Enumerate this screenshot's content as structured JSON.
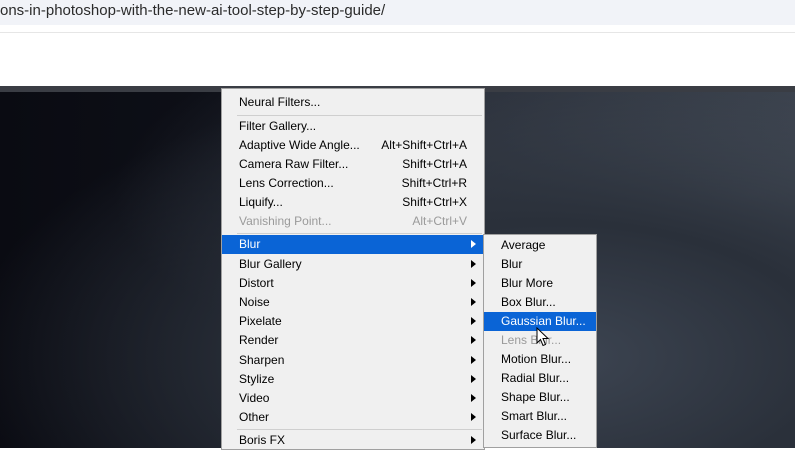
{
  "browser": {
    "url_fragment": "ons-in-photoshop-with-the-new-ai-tool-step-by-step-guide/"
  },
  "filter_menu": {
    "items": [
      {
        "label": "Neural Filters...",
        "shortcut": ""
      },
      {
        "label": "Filter Gallery...",
        "shortcut": ""
      },
      {
        "label": "Adaptive Wide Angle...",
        "shortcut": "Alt+Shift+Ctrl+A"
      },
      {
        "label": "Camera Raw Filter...",
        "shortcut": "Shift+Ctrl+A"
      },
      {
        "label": "Lens Correction...",
        "shortcut": "Shift+Ctrl+R"
      },
      {
        "label": "Liquify...",
        "shortcut": "Shift+Ctrl+X"
      },
      {
        "label": "Vanishing Point...",
        "shortcut": "Alt+Ctrl+V"
      },
      {
        "label": "Blur"
      },
      {
        "label": "Blur Gallery"
      },
      {
        "label": "Distort"
      },
      {
        "label": "Noise"
      },
      {
        "label": "Pixelate"
      },
      {
        "label": "Render"
      },
      {
        "label": "Sharpen"
      },
      {
        "label": "Stylize"
      },
      {
        "label": "Video"
      },
      {
        "label": "Other"
      },
      {
        "label": "Boris FX"
      }
    ]
  },
  "blur_submenu": {
    "items": [
      {
        "label": "Average"
      },
      {
        "label": "Blur"
      },
      {
        "label": "Blur More"
      },
      {
        "label": "Box Blur..."
      },
      {
        "label": "Gaussian Blur..."
      },
      {
        "label": "Lens Blur..."
      },
      {
        "label": "Motion Blur..."
      },
      {
        "label": "Radial Blur..."
      },
      {
        "label": "Shape Blur..."
      },
      {
        "label": "Smart Blur..."
      },
      {
        "label": "Surface Blur..."
      }
    ]
  }
}
